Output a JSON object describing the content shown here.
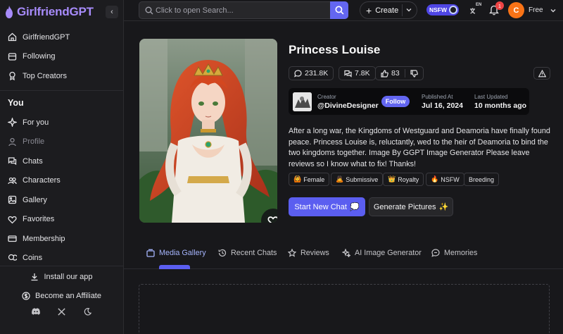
{
  "app": {
    "name": "GirlfriendGPT",
    "brand_color": "#a78bfa",
    "accent_color": "#6366f1"
  },
  "sidebar": {
    "collapse_icon": "chevron-left-icon",
    "top_items": [
      {
        "label": "GirlfriendGPT",
        "icon": "home-icon"
      },
      {
        "label": "Following",
        "icon": "users-icon"
      },
      {
        "label": "Top Creators",
        "icon": "award-icon"
      }
    ],
    "section_title": "You",
    "you_items": [
      {
        "label": "For you",
        "icon": "sparkle-icon"
      },
      {
        "label": "Profile",
        "icon": "user-icon"
      },
      {
        "label": "Chats",
        "icon": "chat-icon"
      },
      {
        "label": "Characters",
        "icon": "characters-icon"
      },
      {
        "label": "Gallery",
        "icon": "image-icon"
      },
      {
        "label": "Favorites",
        "icon": "heart-icon"
      },
      {
        "label": "Membership",
        "icon": "card-icon"
      },
      {
        "label": "Coins",
        "icon": "coins-icon"
      }
    ],
    "install_label": "Install our app",
    "affiliate_label": "Become an Affiliate"
  },
  "topbar": {
    "search_placeholder": "Click to open Search...",
    "create_label": "Create",
    "nsfw_label": "NSFW",
    "lang_code": "EN",
    "notification_count": "1",
    "avatar_letter": "C",
    "plan_label": "Free"
  },
  "character": {
    "name": "Princess Louise",
    "stats": {
      "messages": "231.8K",
      "chats": "7.8K",
      "likes": "83"
    },
    "creator_label": "Creator",
    "creator_name": "@DivineDesigner",
    "follow_label": "Follow",
    "published_label": "Published At",
    "published_value": "Jul 16, 2024",
    "updated_label": "Last Updated",
    "updated_value": "10 months ago",
    "description": "After a long war, the Kingdoms of Westguard and Deamoria have finally found peace. Princess Louise is, reluctantly, wed to the heir of Deamoria to bind the two kingdoms together.   Image By GGPT Image Generator Please leave reviews so I know what to fix! Thanks!",
    "tags": [
      {
        "emoji": "🙆",
        "label": "Female"
      },
      {
        "emoji": "🙇",
        "label": "Submissive"
      },
      {
        "emoji": "👑",
        "label": "Royalty"
      },
      {
        "emoji": "🔥",
        "label": "NSFW"
      },
      {
        "emoji": "",
        "label": "Breeding"
      }
    ],
    "start_chat_label": "Start New Chat",
    "start_chat_emoji": "💭",
    "generate_label": "Generate Pictures",
    "generate_emoji": "✨"
  },
  "tabs": [
    {
      "label": "Media Gallery",
      "icon": "gallery-icon",
      "active": true
    },
    {
      "label": "Recent Chats",
      "icon": "history-icon",
      "active": false
    },
    {
      "label": "Reviews",
      "icon": "star-icon",
      "active": false
    },
    {
      "label": "AI Image Generator",
      "icon": "sparkles-icon",
      "active": false
    },
    {
      "label": "Memories",
      "icon": "memory-icon",
      "active": false
    }
  ]
}
